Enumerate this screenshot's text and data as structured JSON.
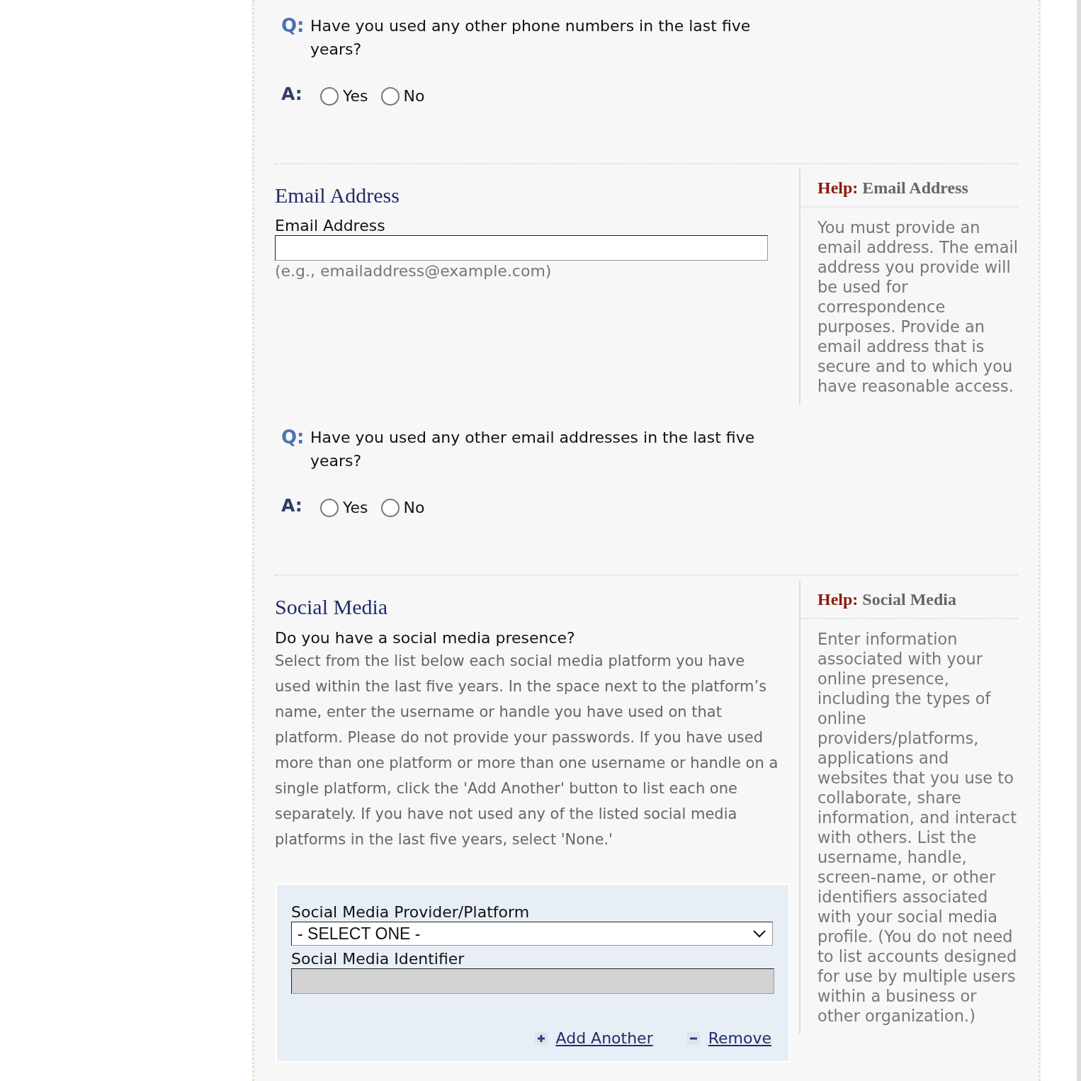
{
  "blocks": [
    {
      "kind": "question",
      "q_label": "Q:",
      "text": "Have you used any other phone numbers in the last five years?",
      "a_label": "A:",
      "options": [
        {
          "label": "Yes",
          "selected": false
        },
        {
          "label": "No",
          "selected": false
        }
      ]
    },
    {
      "kind": "section",
      "title": "Email Address",
      "fields": [
        {
          "kind": "text",
          "label": "Email Address",
          "disabled": false,
          "example_note": "(e.g., emailaddress@example.com)"
        }
      ],
      "help": {
        "label": "Help:",
        "title": "Email Address",
        "text": "You must provide an email address. The email address you provide will be used for correspondence purposes. Provide an email address that is secure and to which you have reasonable access."
      }
    },
    {
      "kind": "question",
      "q_label": "Q:",
      "text": "Have you used any other email addresses in the last five years?",
      "a_label": "A:",
      "options": [
        {
          "label": "Yes",
          "selected": false
        },
        {
          "label": "No",
          "selected": false
        }
      ]
    },
    {
      "kind": "section",
      "title": "Social Media",
      "prompt": "Do you have a social media presence?",
      "instructions": "Select from the list below each social media platform you have used within the last five years. In the space next to the platform’s name, enter the username or handle you have used on that platform. Please do not provide your passwords. If you have used more than one platform or more than one username or handle on a single platform, click the 'Add Another' button to list each one separately. If you have not used any of the listed social media platforms in the last five years, select 'None.'",
      "group": {
        "fields": [
          {
            "kind": "select",
            "label": "Social Media Provider/Platform",
            "value": "- SELECT ONE -",
            "disabled": false
          },
          {
            "kind": "text",
            "label": "Social Media Identifier",
            "disabled": true
          }
        ],
        "actions": [
          {
            "kind": "add",
            "label": "Add Another"
          },
          {
            "kind": "remove",
            "label": "Remove"
          }
        ]
      },
      "help": {
        "label": "Help:",
        "title": "Social Media",
        "text": "Enter information associated with your online presence, including the types of online providers/platforms, applications and websites that you use to collaborate, share information, and interact with others. List the username, handle, screen-name, or other identifiers associated with your social media profile. (You do not need to list accounts designed for use by multiple users within a business or other organization.)"
      }
    }
  ]
}
